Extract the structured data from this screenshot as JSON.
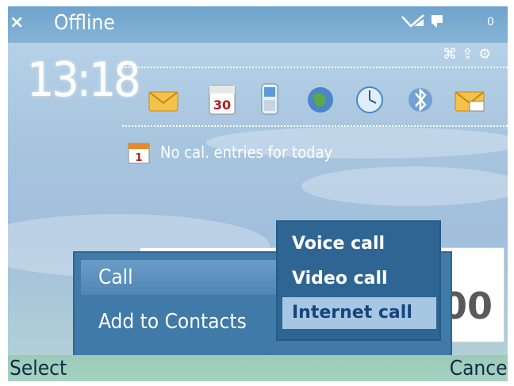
{
  "status_bar": {
    "close_symbol": "×",
    "profile": "Offline",
    "battery_text": "0",
    "small_icons": "⌘⇪⚙"
  },
  "clock": "13:18",
  "shortcuts": [
    {
      "icon": "message-icon"
    },
    {
      "icon": "calendar-icon",
      "label": "30"
    },
    {
      "icon": "phone-icon"
    },
    {
      "icon": "web-globe-icon"
    },
    {
      "icon": "clock-icon"
    },
    {
      "icon": "bluetooth-icon"
    },
    {
      "icon": "email-icon"
    }
  ],
  "calendar_note": {
    "icon_label": "1",
    "text": "No cal. entries for today"
  },
  "dial_field": {
    "digits": "00"
  },
  "options_menu": {
    "items": [
      {
        "label": "Call"
      },
      {
        "label": "Add to Contacts"
      }
    ]
  },
  "call_submenu": {
    "items": [
      {
        "label": "Voice call"
      },
      {
        "label": "Video call"
      },
      {
        "label": "Internet call"
      }
    ]
  },
  "softkeys": {
    "left": "Select",
    "right": "Cancel"
  }
}
